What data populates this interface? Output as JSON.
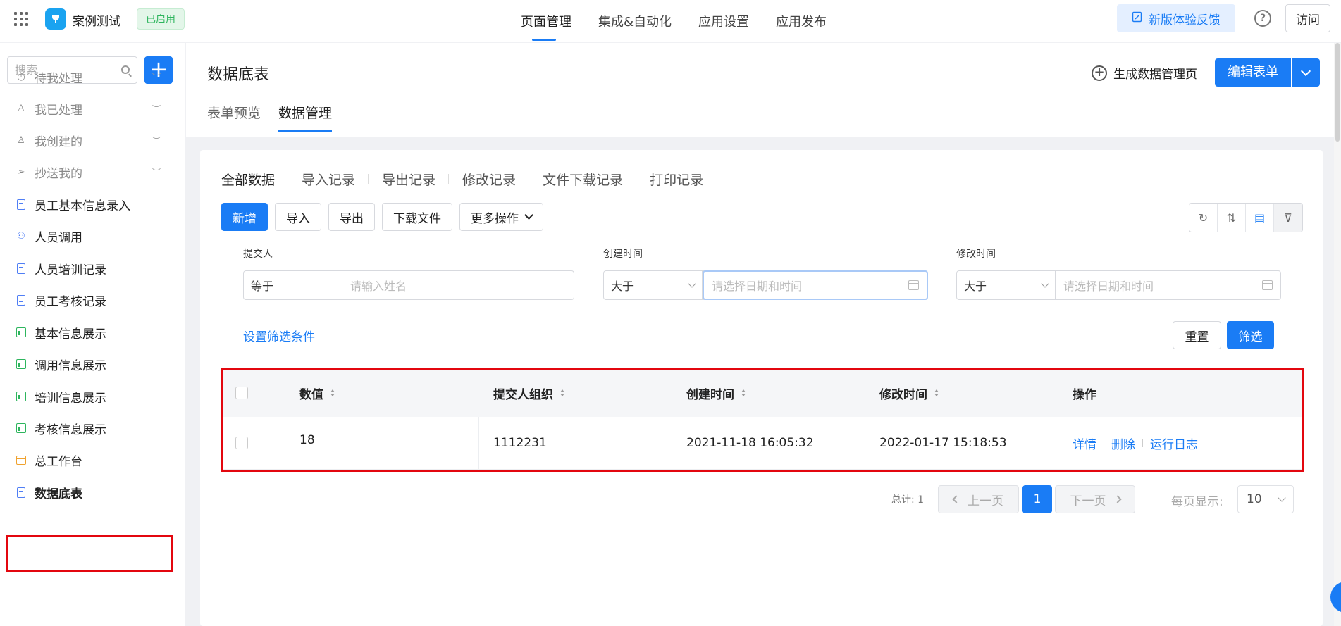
{
  "header": {
    "app_name": "案例测试",
    "status_badge": "已启用",
    "nav": [
      "页面管理",
      "集成&自动化",
      "应用设置",
      "应用发布"
    ],
    "feedback": "新版体验反馈",
    "help": "?",
    "visit": "访问"
  },
  "sidebar": {
    "search_placeholder": "搜索",
    "add": "+",
    "items": [
      {
        "label": "待我处理",
        "icon": "clock-icon"
      },
      {
        "label": "我已处理",
        "icon": "user-check-icon"
      },
      {
        "label": "我创建的",
        "icon": "user-icon"
      },
      {
        "label": "抄送我的",
        "icon": "send-icon"
      },
      {
        "label": "员工基本信息录入",
        "icon": "form-icon"
      },
      {
        "label": "人员调用",
        "icon": "org-icon"
      },
      {
        "label": "人员培训记录",
        "icon": "form-icon"
      },
      {
        "label": "员工考核记录",
        "icon": "form-icon"
      },
      {
        "label": "基本信息展示",
        "icon": "report-icon"
      },
      {
        "label": "调用信息展示",
        "icon": "report-icon"
      },
      {
        "label": "培训信息展示",
        "icon": "report-icon"
      },
      {
        "label": "考核信息展示",
        "icon": "report-icon"
      },
      {
        "label": "总工作台",
        "icon": "dashboard-icon"
      },
      {
        "label": "数据底表",
        "icon": "form-icon"
      }
    ]
  },
  "main": {
    "title": "数据底表",
    "tabs": [
      "表单预览",
      "数据管理"
    ],
    "generate_page": "生成数据管理页",
    "edit_form": "编辑表单"
  },
  "panel": {
    "subtabs": [
      "全部数据",
      "导入记录",
      "导出记录",
      "修改记录",
      "文件下载记录",
      "打印记录"
    ],
    "toolbar": [
      "新增",
      "导入",
      "导出",
      "下载文件",
      "更多操作"
    ],
    "filters": {
      "submitter": {
        "label": "提交人",
        "op": "等于",
        "placeholder": "请输入姓名"
      },
      "created": {
        "label": "创建时间",
        "op": "大于",
        "placeholder": "请选择日期和时间"
      },
      "modified": {
        "label": "修改时间",
        "op": "大于",
        "placeholder": "请选择日期和时间"
      }
    },
    "set_filter": "设置筛选条件",
    "reset": "重置",
    "filter": "筛选"
  },
  "table": {
    "headers": [
      "数值",
      "提交人组织",
      "创建时间",
      "修改时间",
      "操作"
    ],
    "rows": [
      {
        "value": "18",
        "org": "1112231",
        "created": "2021-11-18 16:05:32",
        "modified": "2022-01-17 15:18:53"
      }
    ],
    "actions": [
      "详情",
      "删除",
      "运行日志"
    ]
  },
  "pagination": {
    "total": "总计: 1",
    "prev": "上一页",
    "current": "1",
    "next": "下一页",
    "per_page_label": "每页显示:",
    "per_page": "10"
  },
  "colors": {
    "accent": "#1a7cf5",
    "highlight": "#e3070f",
    "enabled": "#2db55d"
  }
}
